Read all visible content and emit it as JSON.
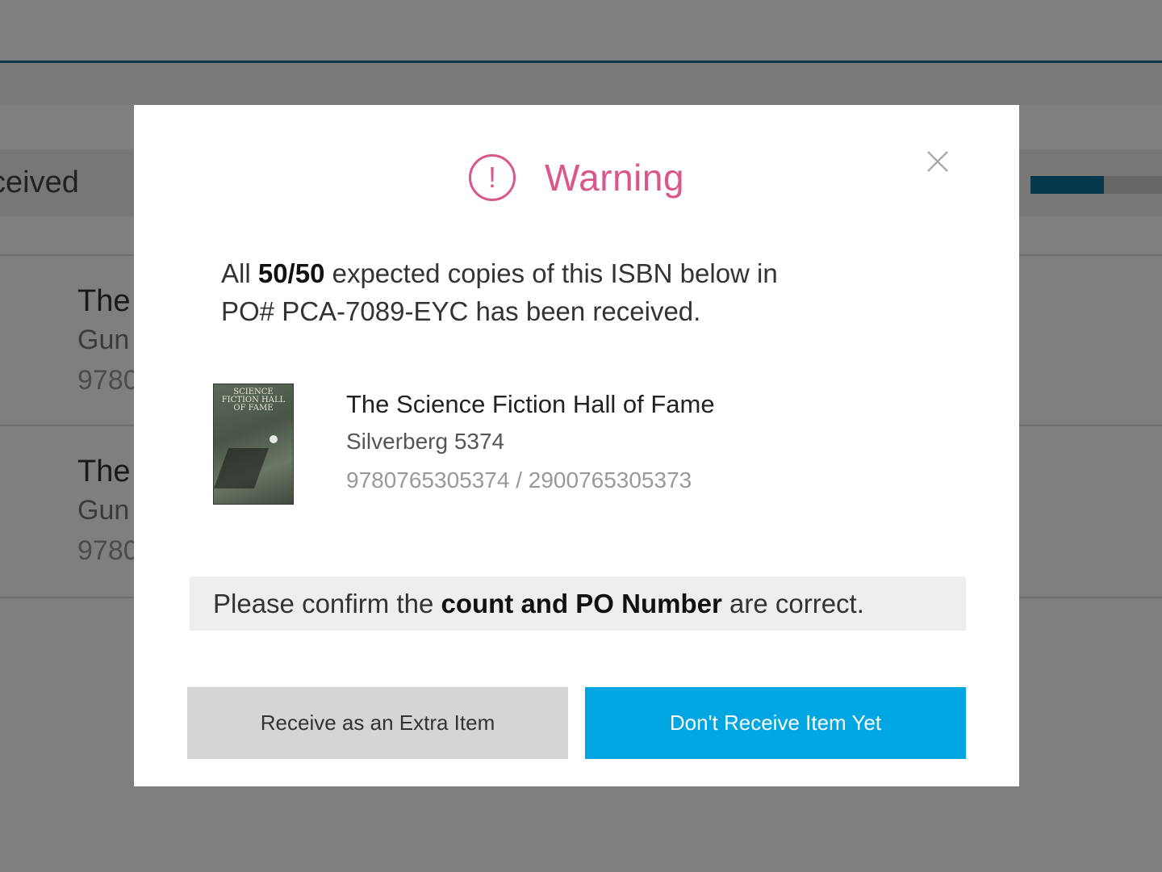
{
  "background": {
    "status_label": "ceived",
    "progress_fraction": 0.56,
    "rows": [
      {
        "title": "The",
        "author": "Gun",
        "isbn": "9780"
      },
      {
        "title": "The",
        "author": "Gun",
        "isbn": "9780"
      }
    ]
  },
  "modal": {
    "title": "Warning",
    "icon": "exclamation-circle-icon",
    "close_icon": "close-icon",
    "message": {
      "prefix": "All ",
      "count": "50/50",
      "middle": " expected copies of this ISBN below in",
      "line2": "PO# PCA-7089-EYC has been received."
    },
    "book": {
      "cover_text": "SCIENCE FICTION HALL OF FAME",
      "title": "The Science Fiction Hall of Fame",
      "author": "Silverberg 5374",
      "isbns": "9780765305374 / 2900765305373"
    },
    "confirm": {
      "prefix": "Please confirm the ",
      "bold": "count and PO Number",
      "suffix": " are correct."
    },
    "buttons": {
      "secondary": "Receive as an Extra Item",
      "primary": "Don't Receive Item Yet"
    }
  },
  "colors": {
    "warning": "#d9578a",
    "primary_button": "#00a6e2",
    "secondary_button": "#d5d5d5",
    "accent_rule": "#0a6f9a"
  }
}
